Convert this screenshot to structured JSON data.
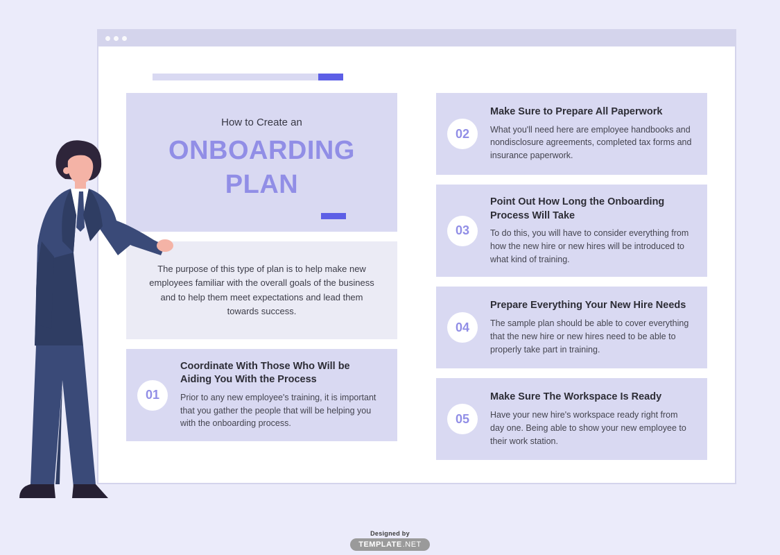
{
  "hero": {
    "kicker": "How to Create an",
    "title": "ONBOARDING PLAN"
  },
  "intro": "The purpose of this type of plan is to help make new employees familiar with the overall goals of the business and to help them meet expectations and lead them towards success.",
  "steps": [
    {
      "num": "01",
      "title": "Coordinate With Those Who Will be Aiding You With the Process",
      "desc": "Prior to any new employee's training, it is important that you gather the people that will be helping you with the onboarding process."
    },
    {
      "num": "02",
      "title": "Make Sure to Prepare All Paperwork",
      "desc": "What you'll need here are employee handbooks and nondisclosure agreements, completed tax forms and insurance paperwork."
    },
    {
      "num": "03",
      "title": "Point Out How Long the Onboarding Process Will Take",
      "desc": "To do this, you will have to consider everything from how the new hire or new hires will be introduced to what kind of training."
    },
    {
      "num": "04",
      "title": "Prepare Everything Your New Hire Needs",
      "desc": "The sample plan should be able to cover everything that the new hire or new hires need to be able to properly take part in training."
    },
    {
      "num": "05",
      "title": "Make Sure The Workspace Is Ready",
      "desc": "Have your new hire's workspace ready right from day one. Being able to show your new employee to their work station."
    }
  ],
  "footer": {
    "designed_by": "Designed by",
    "brand_bold": "TEMPLATE",
    "brand_light": ".NET"
  }
}
